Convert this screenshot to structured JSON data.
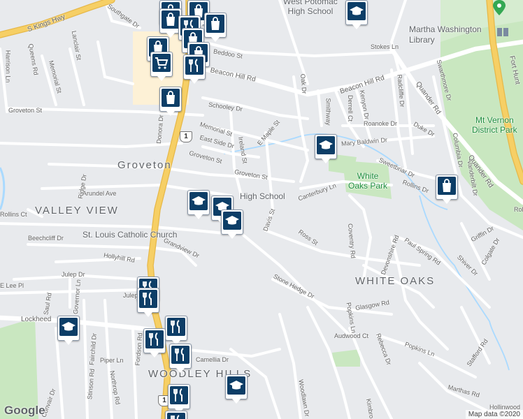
{
  "map": {
    "attribution": "Map data ©2020",
    "provider": "Google",
    "colors": {
      "land": "#e8eaed",
      "road": "#ffffff",
      "highway": "#f6cf65",
      "park": "#c9e7c0",
      "water": "#aadaff",
      "marker": "#0d3e67",
      "commercial": "#fdf1d6"
    }
  },
  "areas": {
    "groveton": "Groveton",
    "valley_view": "VALLEY VIEW",
    "white_oaks": "WHITE OAKS",
    "woodley_hills": "WOODLEY HILLS"
  },
  "pois": {
    "west_potomac": "West Potomac\nHigh School",
    "martha_washington": "Martha Washington\nLibrary",
    "white_oaks_park": "White\nOaks Park",
    "mt_vernon_park": "Mt Vernon\nDistrict Park",
    "high_school": "High School",
    "st_louis": "St. Louis Catholic Church"
  },
  "streets": {
    "s_kings_hwy": "S Kings Hwy",
    "southgate": "Southgate Dr",
    "beacon_hill": "Beacon Hill Rd",
    "beacon_hill2": "Beacon Hill Rd",
    "quander": "Quander Rd",
    "fort_hunt": "Fort Hunt",
    "memorial": "Memorial St",
    "memorial2": "Memorial St",
    "groveton_st": "Groveton St",
    "groveton_st2": "Groveton St",
    "schooley": "Schooley Dr",
    "east_side": "East Side Dr",
    "ireland": "Ireland St",
    "e_maple": "E Maple St",
    "beddoo": "Beddoo St",
    "stokes": "Stokes Ln",
    "oak_dr": "Oak Dr",
    "smithway": "Smithway",
    "kenyon": "Kenyon Dr",
    "derrell": "Derrell Ct",
    "radcliffe": "Radcliffe Dr",
    "roanoke": "Roanoke Dr",
    "duke": "Duke Dr",
    "swarthmore": "Swarthmore Dr",
    "columbia": "Columbia Dr",
    "vanderbilt": "Vanderbilt Dr",
    "sweetbriar": "Sweetbriar Dr",
    "rollins": "Rollins Dr",
    "rollins2": "Rollins Dr",
    "mary_baldwin": "Mary Baldwin Dr",
    "canterbury": "Canterbury Ln",
    "davis": "Davis St",
    "ross": "Ross St",
    "coventry": "Coventry Rd",
    "devonshire": "Devonshire Rd",
    "paul_spring": "Paul Spring Rd",
    "shiver": "Shiver Dr",
    "colgate": "Colgate Dr",
    "griffin": "Griffin Dr",
    "stone_hedge": "Stone Hedge Dr",
    "glasgow": "Glasgow Rd",
    "audwood": "Audwood Ct",
    "rebecca": "Rebecca Dr",
    "popkins": "Popkins Ln",
    "popkins2": "Popkins Ln",
    "stafford": "Stafford Rd",
    "marthas": "Marthas Rd",
    "hollinwood": "Hollinwood",
    "woodlawn": "Woodlawn Dr",
    "kimbro": "Kimbro",
    "arundel": "Arundel Ave",
    "ridge": "Ridge Dr",
    "beechcliff": "Beechcliff Dr",
    "hollyhill": "Hollyhill Rd",
    "grandview": "Grandview Dr",
    "julep": "Julep Dr",
    "julep2": "Julep",
    "e_lee": "E Lee Pl",
    "lockheed": "Lockheed",
    "saul": "Saul Rd",
    "governor": "Governor Ln",
    "fairchild": "Fairchild Dr",
    "fordson": "Fordson Rd",
    "piper": "Piper Ln",
    "stinson": "Stinson Rd",
    "northrop": "Northrop Rd",
    "convair": "Convair Dr",
    "camellia": "Camellia Dr",
    "donora": "Donora Dr",
    "queens": "Queens Rd",
    "lanclair": "Lanclair St",
    "harrison": "Harrison Ln",
    "rollins_w": "Rollins Ct",
    "route1": "1",
    "route1b": "1"
  }
}
